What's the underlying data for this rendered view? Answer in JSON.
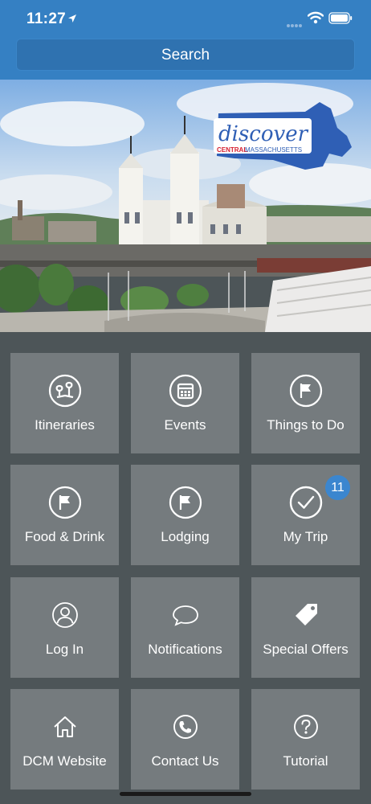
{
  "status_bar": {
    "time": "11:27"
  },
  "search": {
    "label": "Search"
  },
  "hero": {
    "logo_text": "discover",
    "logo_subtext_left": "CENTRAL",
    "logo_subtext_right": "MASSACHUSETTS"
  },
  "tiles": [
    {
      "label": "Itineraries",
      "icon": "map-pins-icon"
    },
    {
      "label": "Events",
      "icon": "calendar-icon"
    },
    {
      "label": "Things to Do",
      "icon": "flag-icon"
    },
    {
      "label": "Food & Drink",
      "icon": "flag-icon"
    },
    {
      "label": "Lodging",
      "icon": "flag-icon"
    },
    {
      "label": "My Trip",
      "icon": "checkmark-icon",
      "badge": "11"
    },
    {
      "label": "Log In",
      "icon": "user-icon"
    },
    {
      "label": "Notifications",
      "icon": "chat-bubble-icon"
    },
    {
      "label": "Special Offers",
      "icon": "tag-icon"
    },
    {
      "label": "DCM Website",
      "icon": "home-icon"
    },
    {
      "label": "Contact Us",
      "icon": "phone-icon"
    },
    {
      "label": "Tutorial",
      "icon": "question-icon"
    }
  ],
  "colors": {
    "header_blue": "#3580c3",
    "tile_gray": "#757b7e",
    "background": "#4d5558",
    "badge_blue": "#3b86cf",
    "logo_red": "#d62030"
  }
}
